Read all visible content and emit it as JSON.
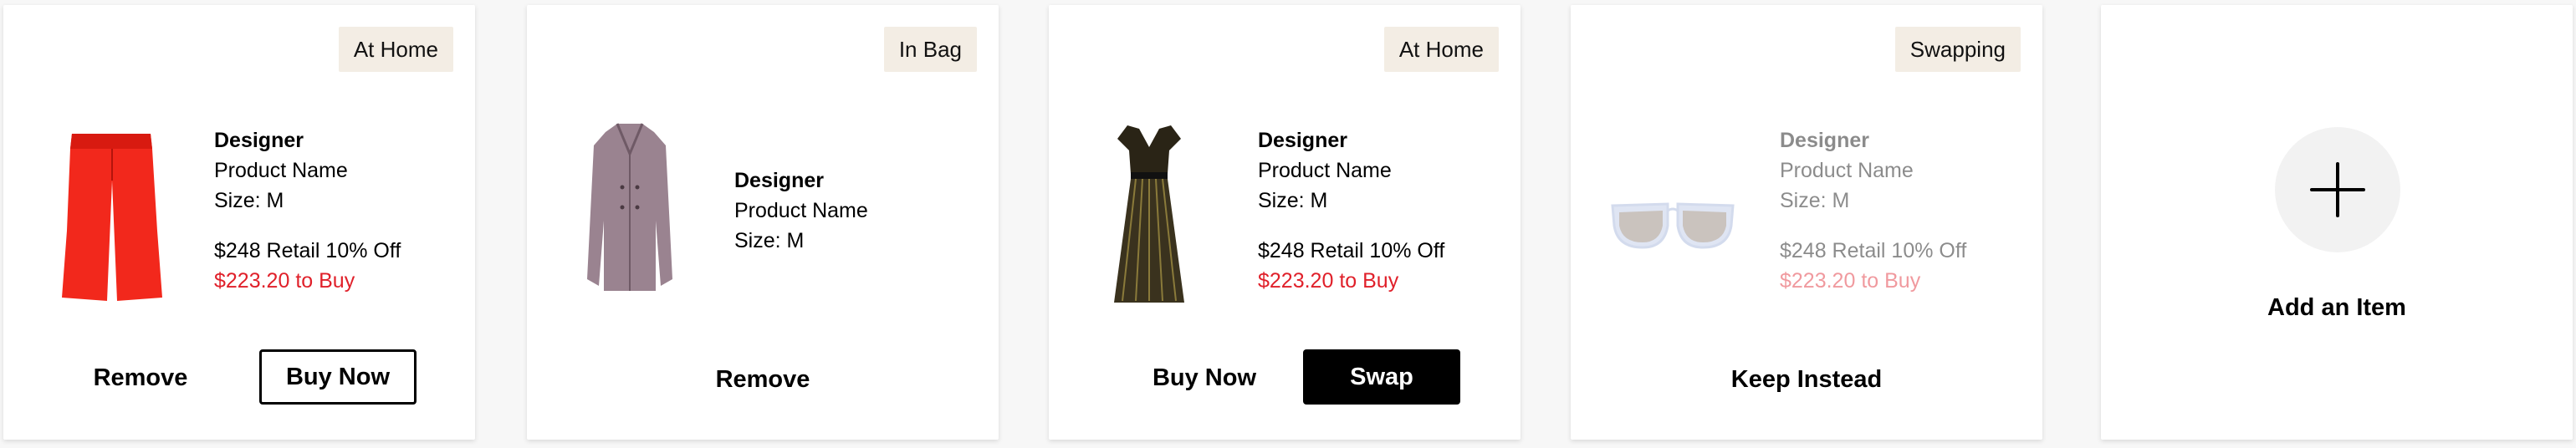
{
  "cards": [
    {
      "status": "At Home",
      "image_icon": "red-culottes-image",
      "designer": "Designer",
      "product_name": "Product Name",
      "size": "Size: M",
      "retail": "$248 Retail 10% Off",
      "buy_price": "$223.20 to Buy",
      "primary_action": "Remove",
      "secondary_action": "Buy Now"
    },
    {
      "status": "In Bag",
      "image_icon": "mauve-coat-image",
      "designer": "Designer",
      "product_name": "Product Name",
      "size": "Size: M",
      "primary_action": "Remove"
    },
    {
      "status": "At Home",
      "image_icon": "black-gold-dress-image",
      "designer": "Designer",
      "product_name": "Product Name",
      "size": "Size: M",
      "retail": "$248 Retail 10% Off",
      "buy_price": "$223.20 to Buy",
      "primary_action": "Buy Now",
      "secondary_action": "Swap"
    },
    {
      "status": "Swapping",
      "image_icon": "clear-sunglasses-image",
      "designer": "Designer",
      "product_name": "Product Name",
      "size": "Size: M",
      "retail": "$248 Retail 10% Off",
      "buy_price": "$223.20 to Buy",
      "primary_action": "Keep Instead"
    }
  ],
  "add_item": {
    "label": "Add an Item",
    "icon": "plus-icon"
  },
  "colors": {
    "badge_bg": "#f3ede4",
    "buy_price": "#e0202a",
    "card_bg": "#ffffff",
    "page_bg": "#f7f7f7"
  }
}
